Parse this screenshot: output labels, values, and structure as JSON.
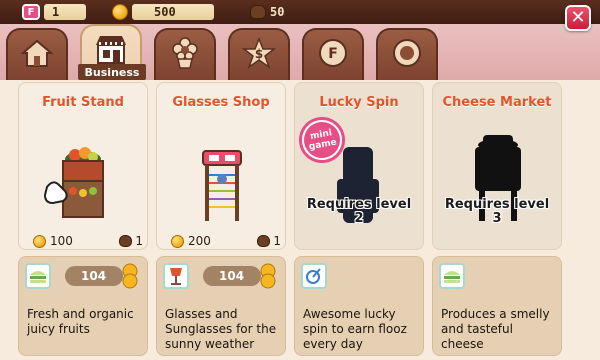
{
  "resources": {
    "flooz": "1",
    "coins": "500",
    "bags": "50"
  },
  "tabs": [
    {
      "name": "home",
      "icon": "house-icon"
    },
    {
      "name": "business",
      "icon": "shop-icon"
    },
    {
      "name": "decor",
      "icon": "flower-icon"
    },
    {
      "name": "bank",
      "icon": "star-dollar-icon"
    },
    {
      "name": "flooz",
      "icon": "flooz-coin-icon"
    },
    {
      "name": "frame",
      "icon": "ring-icon"
    }
  ],
  "active_tab_label": "Business",
  "cards": [
    {
      "title": "Fruit Stand",
      "price_coins": "100",
      "price_bags": "1",
      "locked": false
    },
    {
      "title": "Glasses Shop",
      "price_coins": "200",
      "price_bags": "1",
      "locked": false
    },
    {
      "title": "Lucky Spin",
      "requires": "Requires level",
      "level": "2",
      "badge": "mini game",
      "locked": true
    },
    {
      "title": "Cheese Market",
      "requires": "Requires level",
      "level": "3",
      "locked": true
    }
  ],
  "info": [
    {
      "count": "104",
      "icon": "burger-icon",
      "desc": "Fresh and organic juicy fruits"
    },
    {
      "count": "104",
      "icon": "lamp-icon",
      "desc": "Glasses and Sunglasses for the sunny weather"
    },
    {
      "icon": "spin-icon",
      "desc": "Awesome lucky spin to earn flooz every day"
    },
    {
      "icon": "burger-icon",
      "desc": "Produces a smelly and tasteful cheese"
    }
  ],
  "colors": {
    "title": "#e2542c",
    "tab_brown": "#8a4e36",
    "flooz_pink": "#e84e86",
    "close_red": "#d3284a"
  }
}
